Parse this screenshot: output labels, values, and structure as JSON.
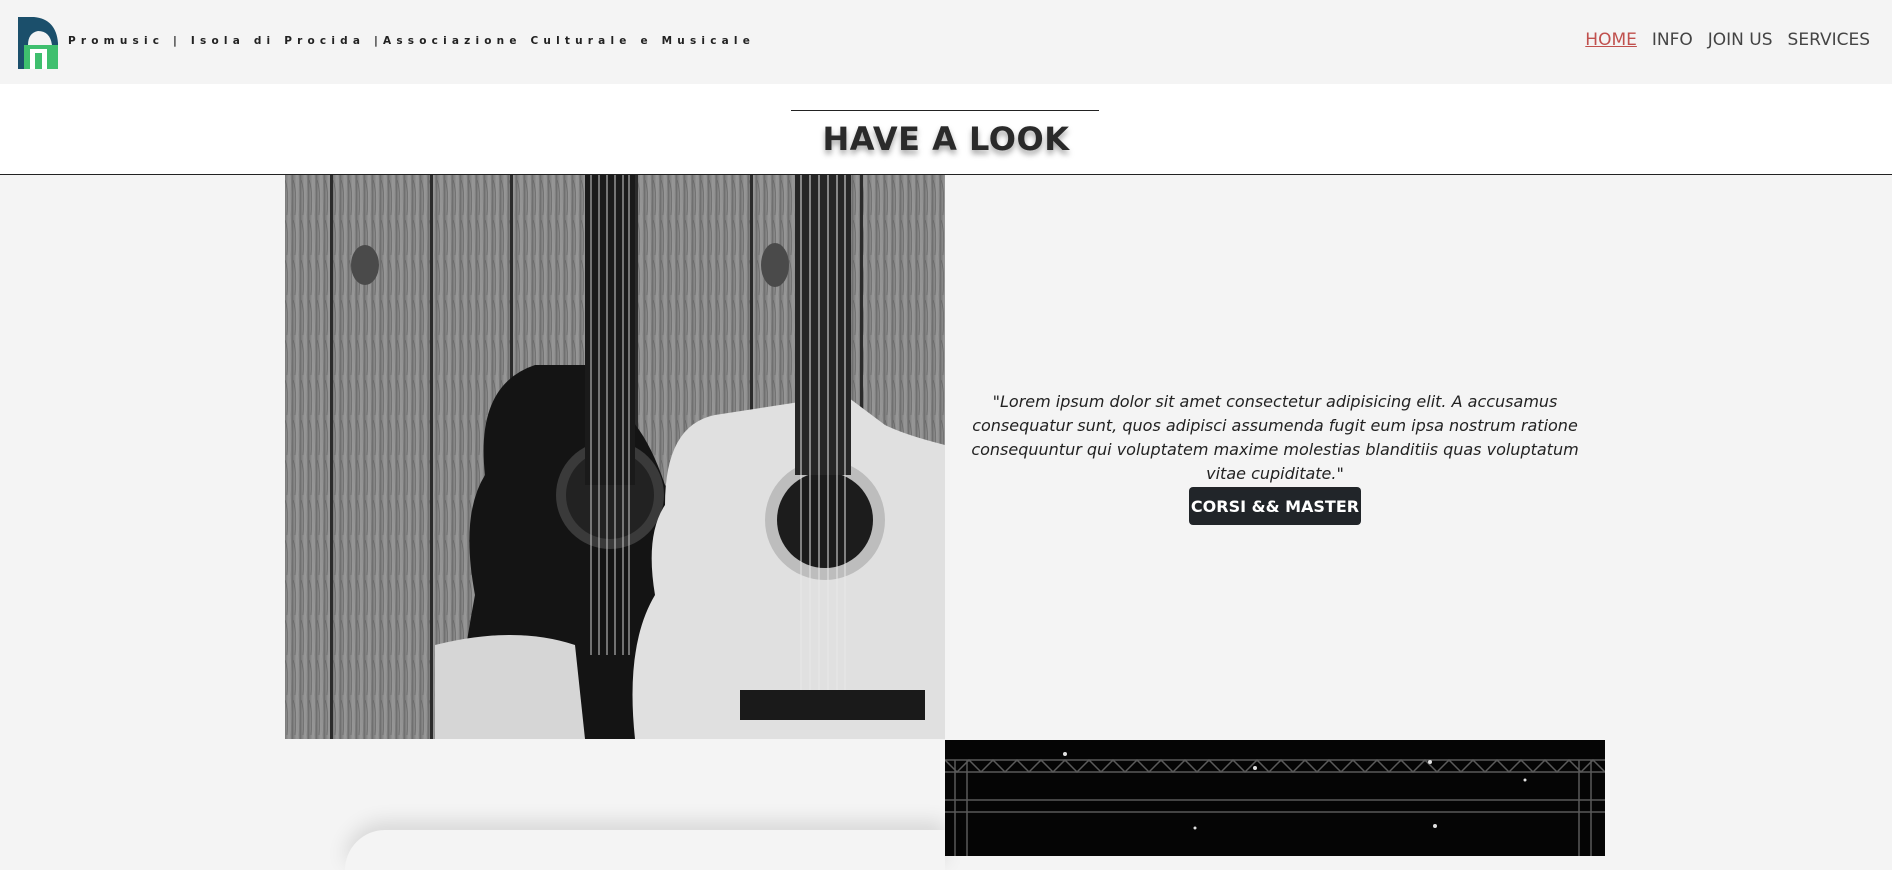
{
  "header": {
    "brand": "Promusic | Isola di Procida |Associazione Culturale e Musicale",
    "logo_icon": "promusic-logo-icon",
    "nav": [
      {
        "label": "HOME",
        "active": true
      },
      {
        "label": "INFO",
        "active": false
      },
      {
        "label": "JOIN US",
        "active": false
      },
      {
        "label": "SERVICES",
        "active": false
      }
    ]
  },
  "section": {
    "title": "HAVE A LOOK"
  },
  "feature": {
    "image_alt": "",
    "quote": "\"Lorem ipsum dolor sit amet consectetur adipisicing elit. A accusamus consequatur sunt, quos adipisci assumenda fugit eum ipsa nostrum ratione consequuntur qui voluptatem maxime molestias blanditiis quas voluptatum vitae cupiditate.\"",
    "button_label": "CORSI && MASTER"
  },
  "colors": {
    "accent_active": "#c0504d",
    "button_bg": "#212529",
    "logo_blue": "#1b4f6b",
    "logo_green": "#3fbf6e"
  }
}
